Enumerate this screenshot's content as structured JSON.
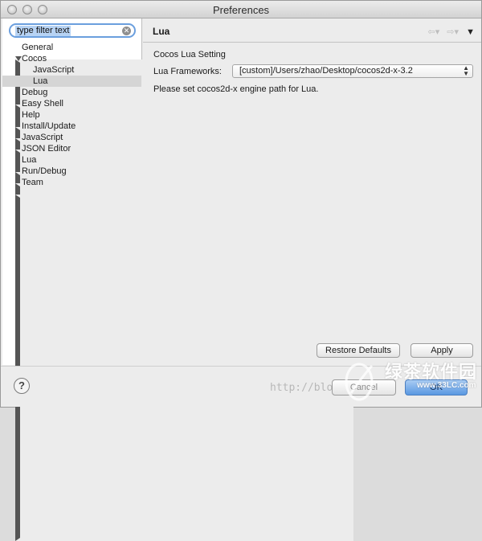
{
  "window": {
    "title": "Preferences"
  },
  "filter": {
    "placeholder": "type filter text"
  },
  "tree": [
    {
      "label": "General",
      "expand": "right",
      "depth": 0
    },
    {
      "label": "Cocos",
      "expand": "down",
      "depth": 0
    },
    {
      "label": "JavaScript",
      "expand": "none",
      "depth": 1
    },
    {
      "label": "Lua",
      "expand": "none",
      "depth": 1,
      "selected": true
    },
    {
      "label": "Debug",
      "expand": "right",
      "depth": 0
    },
    {
      "label": "Easy Shell",
      "expand": "none",
      "depth": 0
    },
    {
      "label": "Help",
      "expand": "right",
      "depth": 0
    },
    {
      "label": "Install/Update",
      "expand": "right",
      "depth": 0
    },
    {
      "label": "JavaScript",
      "expand": "right",
      "depth": 0
    },
    {
      "label": "JSON Editor",
      "expand": "none",
      "depth": 0
    },
    {
      "label": "Lua",
      "expand": "right",
      "depth": 0
    },
    {
      "label": "Run/Debug",
      "expand": "right",
      "depth": 0
    },
    {
      "label": "Team",
      "expand": "right",
      "depth": 0
    }
  ],
  "page": {
    "title": "Lua",
    "section_title": "Cocos Lua Setting",
    "frameworks_label": "Lua Frameworks:",
    "frameworks_value": "[custom]/Users/zhao/Desktop/cocos2d-x-3.2",
    "hint": "Please set cocos2d-x engine path for Lua."
  },
  "buttons": {
    "restore_defaults": "Restore Defaults",
    "apply": "Apply",
    "cancel": "Cancel",
    "ok": "OK",
    "help": "?"
  },
  "watermark": {
    "url": "http://blo",
    "brand_cn": "绿茶软件园",
    "domain": "www.33LC.com"
  },
  "colors": {
    "selection": "#d5d5d5",
    "focus_ring": "#6b9fde",
    "default_button": "#5a98e2"
  }
}
